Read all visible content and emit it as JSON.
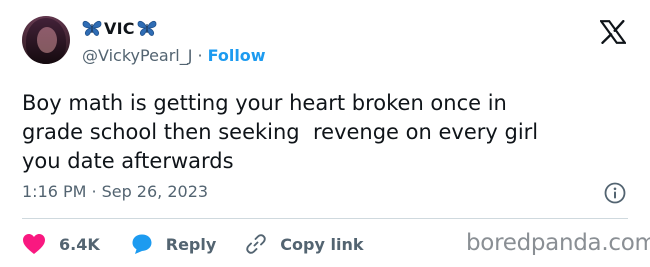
{
  "user": {
    "display_name": "VIC",
    "handle": "@VickyPearl_J",
    "separator": "·",
    "follow_label": "Follow",
    "name_emoji": "butterfly-icon"
  },
  "tweet": {
    "text": "Boy math is getting your heart broken once in\ngrade school then seeking  revenge on every girl\nyou date afterwards",
    "time": "1:16 PM",
    "separator": "·",
    "date": "Sep 26, 2023"
  },
  "actions": {
    "likes": "6.4K",
    "reply_label": "Reply",
    "copy_link_label": "Copy link"
  },
  "watermark": "boredpanda.com",
  "colors": {
    "accent": "#1d9bf0",
    "like": "#f91880",
    "text": "#0f1419",
    "muted": "#536471",
    "divider": "#cfd9de"
  },
  "icons": [
    "x-logo-icon",
    "info-icon",
    "heart-icon",
    "reply-bubble-icon",
    "link-icon",
    "butterfly-icon"
  ]
}
